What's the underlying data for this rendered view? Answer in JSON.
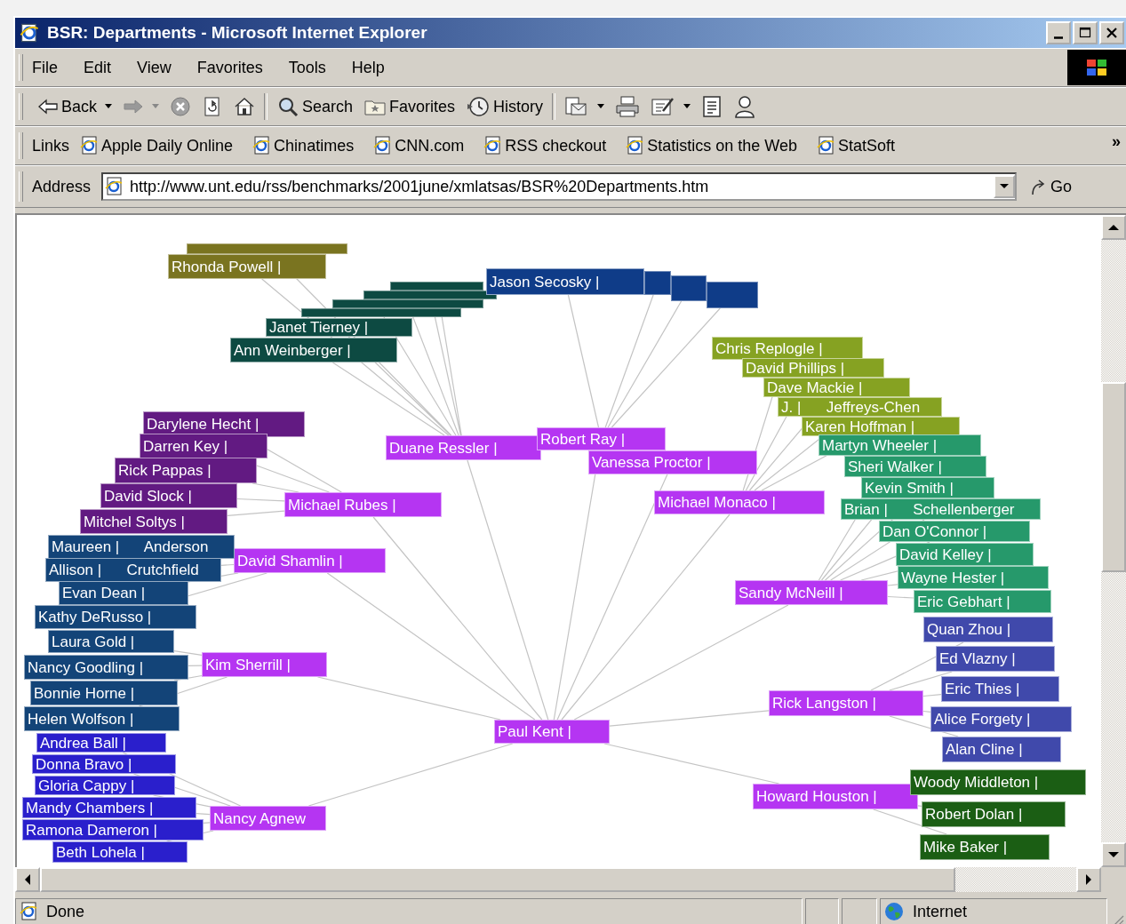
{
  "window": {
    "title": "BSR: Departments - Microsoft Internet Explorer"
  },
  "menu": [
    "File",
    "Edit",
    "View",
    "Favorites",
    "Tools",
    "Help"
  ],
  "toolbar": [
    {
      "kind": "back",
      "label": "Back"
    },
    {
      "kind": "forward"
    },
    {
      "kind": "stop"
    },
    {
      "kind": "refresh"
    },
    {
      "kind": "home"
    },
    {
      "kind": "search",
      "label": "Search"
    },
    {
      "kind": "favorites",
      "label": "Favorites"
    },
    {
      "kind": "history",
      "label": "History"
    },
    {
      "kind": "mail"
    },
    {
      "kind": "print"
    },
    {
      "kind": "edit"
    },
    {
      "kind": "discuss"
    },
    {
      "kind": "messenger"
    }
  ],
  "links": {
    "label": "Links",
    "items": [
      "Apple Daily Online",
      "Chinatimes",
      "CNN.com",
      "RSS checkout",
      "Statistics on the Web",
      "StatSoft"
    ],
    "more": "»"
  },
  "address": {
    "label": "Address",
    "value": "http://www.unt.edu/rss/benchmarks/2001june/xmlatsas/BSR%20Departments.htm",
    "go": "Go"
  },
  "tree": {
    "root": {
      "label": "Paul Kent |",
      "color": "#b535f2",
      "children": [
        {
          "label": "Duane Ressler |",
          "color": "#b535f2",
          "children": [
            {
              "kind": "covered",
              "color": "#7a7420"
            },
            {
              "label": "Rhonda Powell |",
              "color": "#7a7420"
            },
            {
              "kind": "covered",
              "color": "#0d4a42"
            },
            {
              "kind": "covered",
              "color": "#0d4a42"
            },
            {
              "kind": "covered",
              "color": "#0d4a42"
            },
            {
              "kind": "covered",
              "color": "#0d4a42"
            },
            {
              "label": "Janet Tierney |",
              "color": "#0d4a42"
            },
            {
              "label": "Ann Weinberger |",
              "color": "#0d4a42"
            }
          ]
        },
        {
          "label": "Robert Ray |",
          "color": "#b535f2",
          "children": [
            {
              "kind": "covered",
              "color": "#0f3c88"
            },
            {
              "kind": "covered",
              "color": "#0f3c88"
            },
            {
              "kind": "covered",
              "color": "#0f3c88"
            },
            {
              "label": "Jason Secosky |",
              "color": "#0f3c88"
            }
          ]
        },
        {
          "label": "Vanessa Proctor |",
          "color": "#b535f2"
        },
        {
          "label": "Michael Monaco |",
          "color": "#b535f2",
          "children": [
            {
              "label": "Chris Replogle |",
              "color": "#86a222"
            },
            {
              "label": "David Phillips |",
              "color": "#86a222"
            },
            {
              "label": "Dave Mackie |",
              "color": "#86a222"
            },
            {
              "label": "J. |      Jeffreys-Chen",
              "color": "#86a222"
            },
            {
              "label": "Karen Hoffman |",
              "color": "#86a222"
            }
          ]
        },
        {
          "label": "Sandy McNeill |",
          "color": "#b535f2",
          "children": [
            {
              "label": "Martyn Wheeler |",
              "color": "#26996b"
            },
            {
              "label": "Sheri Walker |",
              "color": "#26996b"
            },
            {
              "label": "Kevin Smith |",
              "color": "#26996b"
            },
            {
              "label": "Brian |      Schellenberger",
              "color": "#26996b"
            },
            {
              "label": "Dan O'Connor |",
              "color": "#26996b"
            },
            {
              "label": "David Kelley |",
              "color": "#26996b"
            },
            {
              "label": "Wayne Hester |",
              "color": "#26996b"
            },
            {
              "label": "Eric Gebhart |",
              "color": "#26996b"
            }
          ]
        },
        {
          "label": "Rick Langston |",
          "color": "#b535f2",
          "children": [
            {
              "label": "Quan Zhou |",
              "color": "#4049ab"
            },
            {
              "label": "Ed Vlazny |",
              "color": "#4049ab"
            },
            {
              "label": "Eric Thies |",
              "color": "#4049ab"
            },
            {
              "label": "Alice Forgety |",
              "color": "#4049ab"
            },
            {
              "label": "Alan Cline |",
              "color": "#4049ab"
            }
          ]
        },
        {
          "label": "Howard Houston |",
          "color": "#b535f2",
          "children": [
            {
              "label": "Woody Middleton |",
              "color": "#1b5e14"
            },
            {
              "label": "Robert Dolan |",
              "color": "#1b5e14"
            },
            {
              "label": "Mike Baker |",
              "color": "#1b5e14"
            }
          ]
        },
        {
          "label": "Michael Rubes |",
          "color": "#b535f2",
          "children": [
            {
              "label": "Darylene Hecht |",
              "color": "#621a82"
            },
            {
              "label": "Darren Key |",
              "color": "#621a82"
            },
            {
              "label": "Rick Pappas |",
              "color": "#621a82"
            },
            {
              "label": "David Slock |",
              "color": "#621a82"
            },
            {
              "label": "Mitchel Soltys |",
              "color": "#621a82"
            }
          ]
        },
        {
          "label": "David Shamlin |",
          "color": "#b535f2",
          "children": [
            {
              "label": "Maureen |      Anderson",
              "color": "#134478"
            },
            {
              "label": "Allison |      Crutchfield",
              "color": "#134478"
            },
            {
              "label": "Evan Dean |",
              "color": "#134478"
            },
            {
              "label": "Kathy DeRusso |",
              "color": "#134478"
            }
          ]
        },
        {
          "label": "Kim Sherrill |",
          "color": "#b535f2",
          "children": [
            {
              "label": "Laura Gold |",
              "color": "#134478"
            },
            {
              "label": "Nancy Goodling |",
              "color": "#134478"
            },
            {
              "label": "Bonnie Horne |",
              "color": "#134478"
            },
            {
              "label": "Helen Wolfson |",
              "color": "#134478"
            }
          ]
        },
        {
          "label": "Nancy Agnew",
          "color": "#b535f2",
          "children": [
            {
              "label": "Andrea Ball |",
              "color": "#2a1fcc"
            },
            {
              "label": "Donna Bravo |",
              "color": "#2a1fcc"
            },
            {
              "label": "Gloria Cappy |",
              "color": "#2a1fcc"
            },
            {
              "label": "Mandy Chambers |",
              "color": "#2a1fcc"
            },
            {
              "label": "Ramona Dameron |",
              "color": "#2a1fcc"
            },
            {
              "label": "Beth Lohela |",
              "color": "#2a1fcc"
            }
          ]
        }
      ]
    }
  },
  "status_bar": {
    "text": "Done",
    "zone": "Internet"
  }
}
